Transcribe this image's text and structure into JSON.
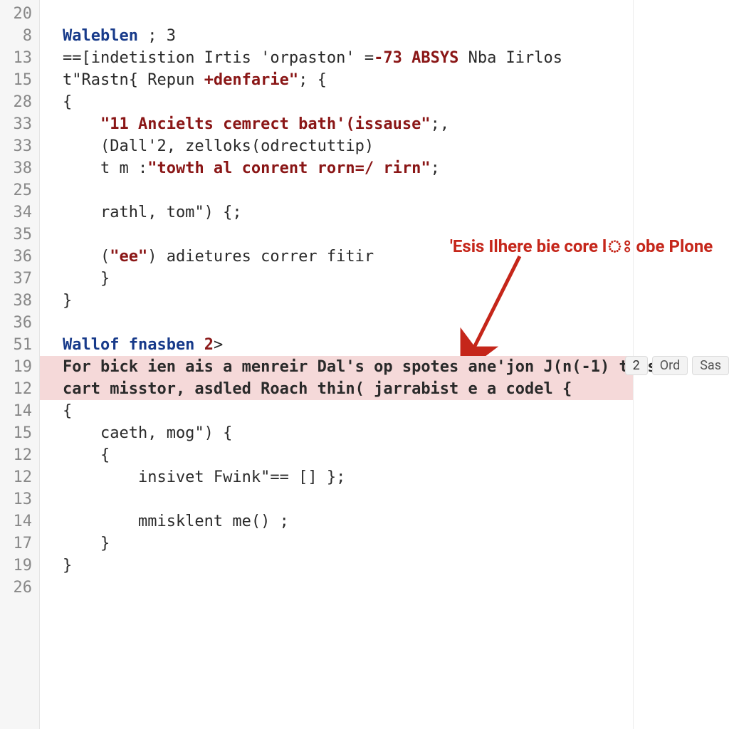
{
  "gutter": [
    "20",
    "8",
    "13",
    "15",
    "28",
    "33",
    "33",
    "38",
    "25",
    "34",
    "35",
    "36",
    "37",
    "38",
    "36",
    "51",
    "19",
    "12",
    "14",
    "15",
    "12",
    "12",
    "13",
    "14",
    "17",
    "19",
    "26"
  ],
  "lines": {
    "l0": {
      "blank": ""
    },
    "l1": {
      "a": "Waleblen",
      "b": " ; ",
      "c": "3"
    },
    "l2": {
      "a": "==",
      "b": "[indetistion Irtis 'orpaston' ",
      "c": "=",
      "d": "-73 ABSYS",
      "e": " Nba Iirlos"
    },
    "l3": {
      "a": "t",
      "b": "\"Rastn{ Repun ",
      "c": "+denfarie\"",
      "d": "; {"
    },
    "l4": {
      "a": "{"
    },
    "l5": {
      "a": "    ",
      "b": "\"11 Ancielts cemrect bath'(issause\"",
      "c": ";,"
    },
    "l6": {
      "a": "    (Dall'2, zelloks(odrectuttip)"
    },
    "l7": {
      "a": "    t m :",
      "b": "\"towth al conrent rorn=/ rirn\"",
      "c": ";"
    },
    "l8": {
      "a": ""
    },
    "l9": {
      "a": "    rathl, tom",
      "b": "\") {;"
    },
    "l10": {
      "a": ""
    },
    "l11": {
      "a": "    (",
      "b": "\"ee\"",
      "c": ") adietures correr fitir"
    },
    "l12": {
      "a": "    }"
    },
    "l13": {
      "a": "}"
    },
    "l14": {
      "a": ""
    },
    "l15": {
      "a": "Wallof fnasben ",
      "b": "2",
      "c": ">"
    },
    "l16": {
      "a": "For bick ien ais a menreir Dal's op spotes ane'jon J(n(-1) thise"
    },
    "l17": {
      "a": "cart misstor, asdled Roach thin( jarrabist e a codel {"
    },
    "l18": {
      "a": "{"
    },
    "l19": {
      "a": "    caeth, mog",
      "b": "\") {"
    },
    "l20": {
      "a": "    {"
    },
    "l21": {
      "a": "        insivet Fwink",
      "b": "\"== []",
      "c": " };"
    },
    "l22": {
      "a": ""
    },
    "l23": {
      "a": "        mmisklent me() ;"
    },
    "l24": {
      "a": "    }"
    },
    "l25": {
      "a": "}"
    },
    "l26": {
      "a": ""
    }
  },
  "annotation": "'Esis Ilhere bie core lঃ obe Plone",
  "side": {
    "count": "2",
    "ord": "Ord",
    "sas": "Sas"
  }
}
